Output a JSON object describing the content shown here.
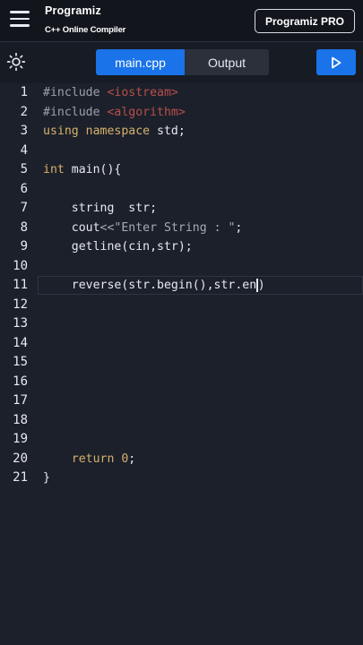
{
  "header": {
    "brand": "Programiz",
    "subtitle": "C++ Online Compiler",
    "pro_label": "Programiz PRO"
  },
  "tabs": [
    {
      "label": "main.cpp",
      "active": true
    },
    {
      "label": "Output",
      "active": false
    }
  ],
  "line_numbers": [
    "1",
    "2",
    "3",
    "4",
    "5",
    "6",
    "7",
    "8",
    "9",
    "10",
    "11",
    "12",
    "13",
    "14",
    "15",
    "16",
    "17",
    "18",
    "19",
    "20",
    "21"
  ],
  "code": {
    "l1": {
      "a": "#include ",
      "b": "<iostream>"
    },
    "l2": {
      "a": "#include ",
      "b": "<algorithm>"
    },
    "l3": {
      "a": "using ",
      "b": "namespace ",
      "c": "std;"
    },
    "l5": {
      "a": "int ",
      "b": "main(){"
    },
    "l7": {
      "a": "    string  str;"
    },
    "l8": {
      "a": "    cout",
      "b": "<<",
      "c": "\"Enter String : \"",
      "d": ";"
    },
    "l9": {
      "a": "    getline(cin,str);"
    },
    "l11": {
      "a": "    reverse(str.begin(),str.en",
      "b": ")"
    },
    "l20": {
      "a": "    return ",
      "b": "0",
      "c": ";"
    },
    "l21": {
      "a": "}"
    }
  },
  "colors": {
    "accent": "#1a73e8",
    "editor_bg": "#1c202b",
    "keyword": "#d6b26a",
    "include_target": "#b84f4a"
  }
}
